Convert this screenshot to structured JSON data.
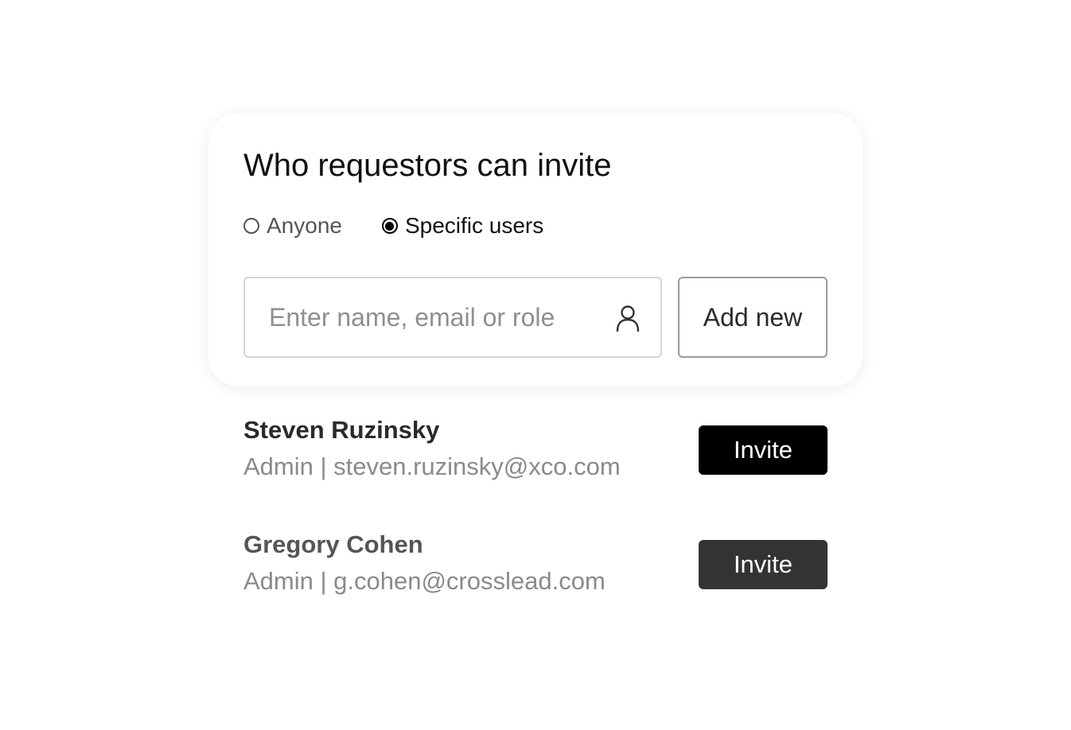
{
  "section": {
    "title": "Who requestors can invite"
  },
  "radio_options": [
    {
      "label": "Anyone",
      "checked": false
    },
    {
      "label": "Specific users",
      "checked": true
    }
  ],
  "search": {
    "placeholder": "Enter name, email or role",
    "value": "",
    "icon": "user-icon"
  },
  "add_new": {
    "label": "Add new"
  },
  "users": [
    {
      "name": "Steven Ruzinsky",
      "meta": "Admin | steven.ruzinsky@xco.com",
      "action_label": "Invite",
      "name_color": "#2a2a2a",
      "button_color": "#000000"
    },
    {
      "name": "Gregory Cohen",
      "meta": "Admin | g.cohen@crosslead.com",
      "action_label": "Invite",
      "name_color": "#555555",
      "button_color": "#333333"
    }
  ]
}
